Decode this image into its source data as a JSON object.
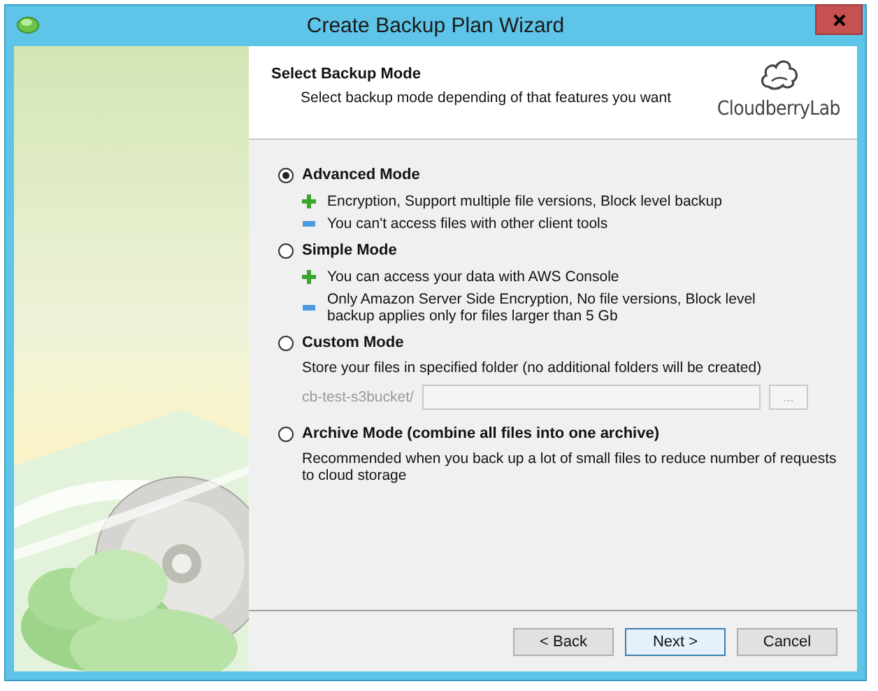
{
  "window": {
    "title": "Create Backup Plan Wizard"
  },
  "header": {
    "title": "Select Backup Mode",
    "subtitle": "Select backup mode depending of that features you want",
    "logo_text": "CloudberryLab"
  },
  "modes": [
    {
      "label": "Advanced Mode",
      "selected": true,
      "features": [
        {
          "kind": "plus",
          "text": "Encryption, Support multiple file versions, Block level backup"
        },
        {
          "kind": "minus",
          "text": "You can't access files with other client tools"
        }
      ]
    },
    {
      "label": "Simple Mode",
      "selected": false,
      "features": [
        {
          "kind": "plus",
          "text": "You can access your data with AWS Console"
        },
        {
          "kind": "minus",
          "text": "Only Amazon Server Side Encryption, No file versions, Block level backup applies only for files larger than 5 Gb"
        }
      ]
    },
    {
      "label": "Custom Mode",
      "selected": false,
      "description": "Store your files in specified folder (no additional folders will be created)",
      "folder": {
        "prefix": "cb-test-s3bucket/",
        "browse": "...",
        "disabled": true
      }
    },
    {
      "label": "Archive Mode (combine all files into one archive)",
      "selected": false,
      "description": "Recommended when you back up a lot of small files to reduce number of requests to cloud storage"
    }
  ],
  "buttons": [
    {
      "label": "< Back",
      "default": false
    },
    {
      "label": "Next >",
      "default": true
    },
    {
      "label": "Cancel",
      "default": false
    }
  ]
}
